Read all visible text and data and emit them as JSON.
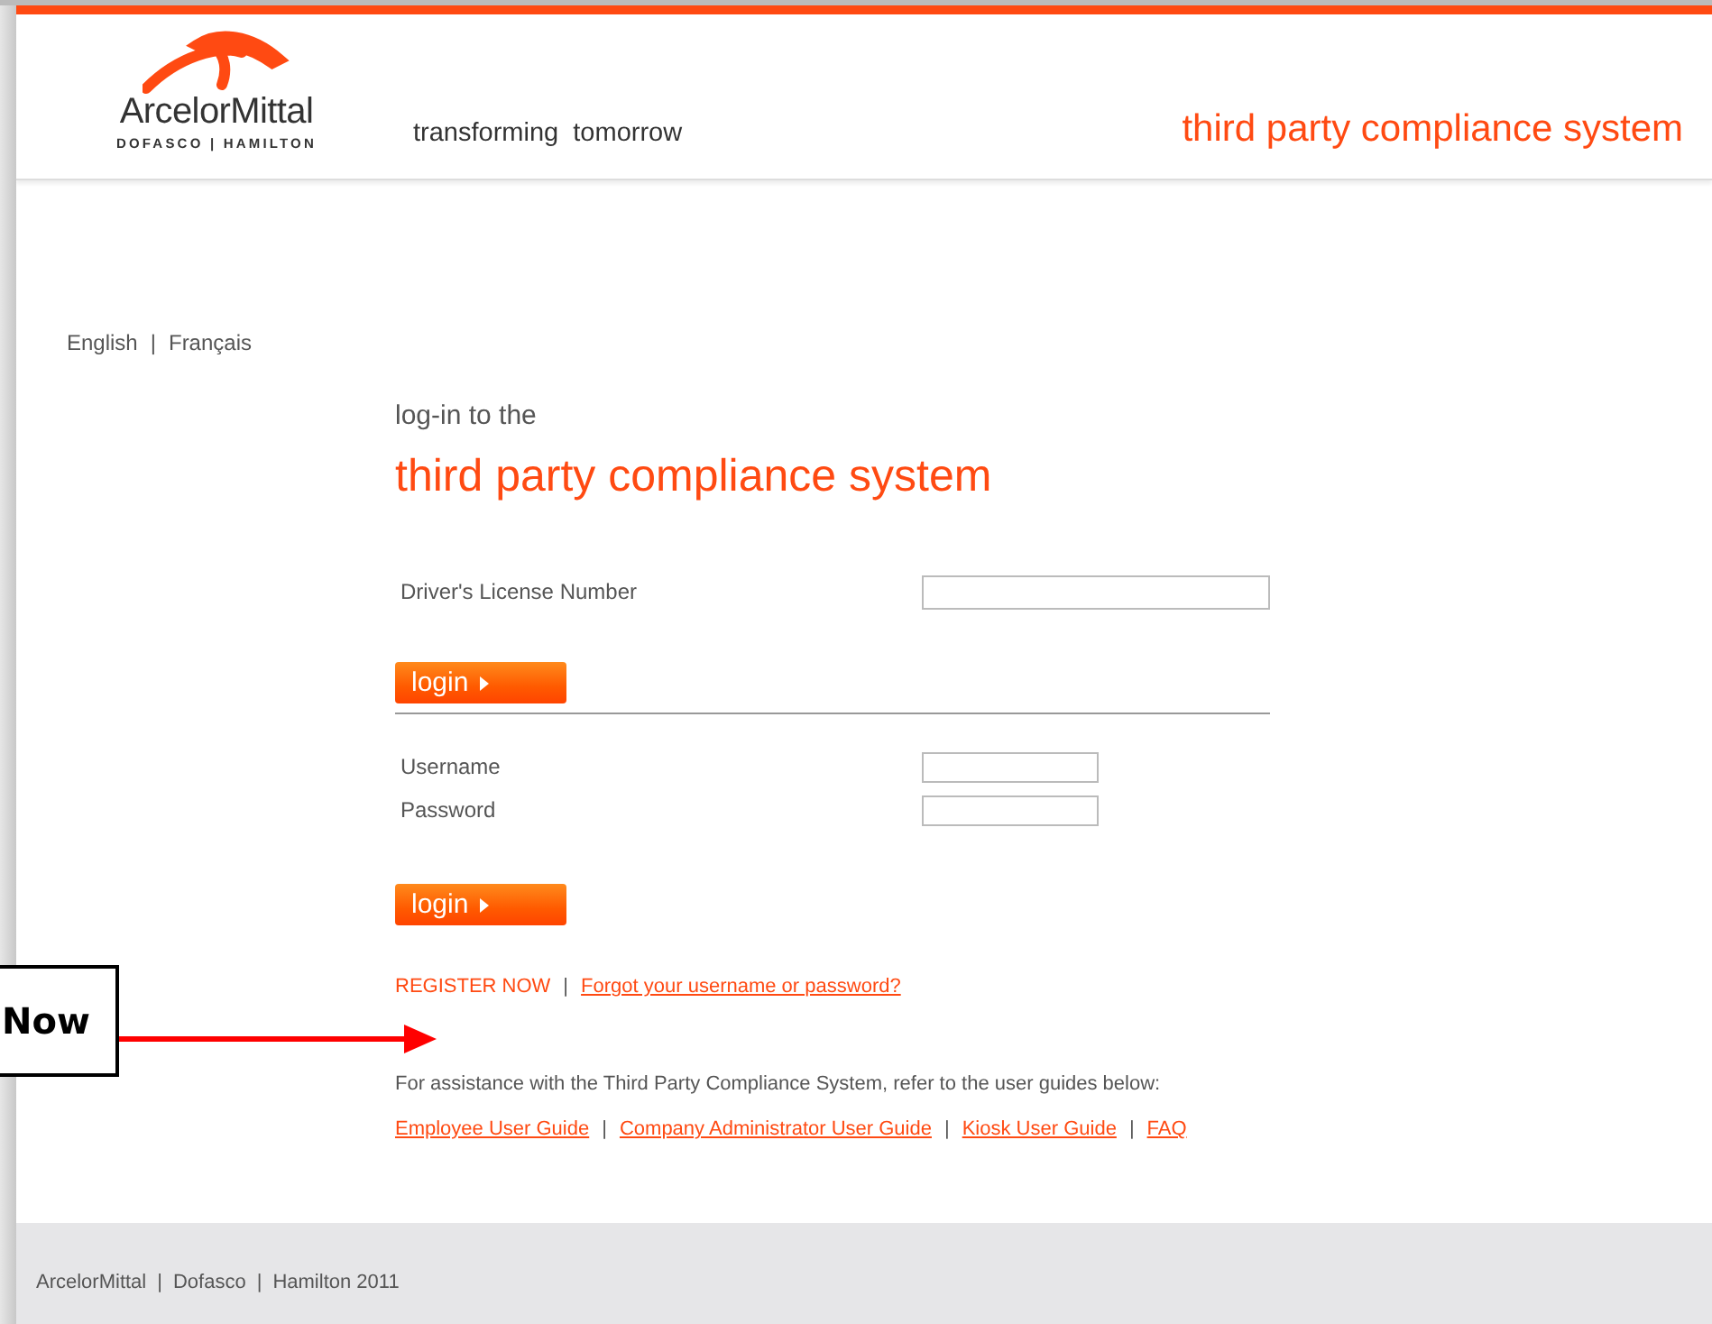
{
  "header": {
    "logo_name": "ArcelorMittal",
    "logo_sub": "DOFASCO | HAMILTON",
    "tagline": "transforming  tomorrow",
    "system_title": "third party compliance system"
  },
  "languages": {
    "separator": "|",
    "items": [
      {
        "label": "English"
      },
      {
        "label": "Français"
      }
    ]
  },
  "login": {
    "intro": "log-in to the",
    "title": "third party compliance system",
    "license_section": {
      "fields": [
        {
          "label": "Driver's License Number",
          "kind": "wide"
        }
      ],
      "button": "login"
    },
    "account_section": {
      "fields": [
        {
          "label": "Username",
          "kind": "narrow"
        },
        {
          "label": "Password",
          "kind": "narrow"
        }
      ],
      "button": "login"
    },
    "register": {
      "separator": "|",
      "items": [
        {
          "label": "REGISTER NOW",
          "kind": "plain"
        },
        {
          "label": "Forgot your username or password?",
          "kind": "underlined"
        }
      ]
    },
    "assistance": "For assistance with the Third Party Compliance System, refer to the user guides below:",
    "guides": {
      "separator": "|",
      "items": [
        {
          "label": "Employee User Guide"
        },
        {
          "label": "Company Administrator User Guide"
        },
        {
          "label": "Kiosk User Guide"
        },
        {
          "label": "FAQ"
        }
      ]
    }
  },
  "callout": {
    "text": "Now"
  },
  "footer": {
    "separator": "|",
    "items": [
      "ArcelorMittal",
      "Dofasco",
      "Hamilton 2011"
    ]
  }
}
